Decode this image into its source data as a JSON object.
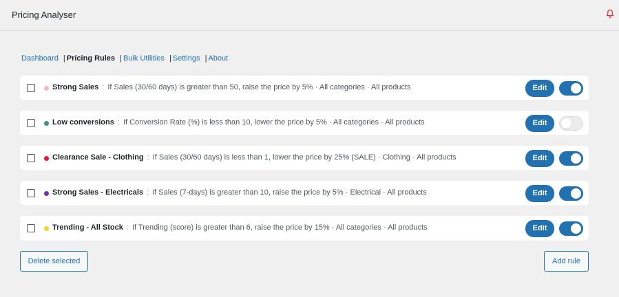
{
  "app": {
    "title": "Pricing Analyser"
  },
  "nav": {
    "items": [
      {
        "label": "Dashboard"
      },
      {
        "label": "Pricing Rules"
      },
      {
        "label": "Bulk Utilities"
      },
      {
        "label": "Settings"
      },
      {
        "label": "About"
      }
    ],
    "separator": "|",
    "current": "Pricing Rules"
  },
  "rules": [
    {
      "name": "Strong Sales",
      "description": "If Sales (30/60 days) is greater than 50, raise the price by 5% · All categories · All products",
      "color": "#f4b8c6",
      "enabled": true
    },
    {
      "name": "Low conversions",
      "description": "If Conversion Rate (%) is less than 10, lower the price by 5% · All categories · All products",
      "color": "#3f8f85",
      "enabled": false
    },
    {
      "name": "Clearance Sale - Clothing",
      "description": "If Sales (30/60 days) is less than 1, lower the price by 25% (SALE) · Clothing · All products",
      "color": "#e3173b",
      "enabled": true
    },
    {
      "name": "Strong Sales - Electricals",
      "description": "If Sales (7-days) is greater than 10, raise the price by 5% · Electrical · All products",
      "color": "#7b2cae",
      "enabled": true
    },
    {
      "name": "Trending - All Stock",
      "description": "If Trending (score) is greater than 6, raise the price by 15% · All categories · All products",
      "color": "#f2d62b",
      "enabled": true
    }
  ],
  "rule_separator": ":",
  "edit_label": "Edit",
  "actions": {
    "delete_selected": "Delete selected",
    "add_rule": "Add rule"
  },
  "colors": {
    "accent": "#2271b1",
    "background": "#f0f0f1",
    "notification": "#d63638"
  }
}
